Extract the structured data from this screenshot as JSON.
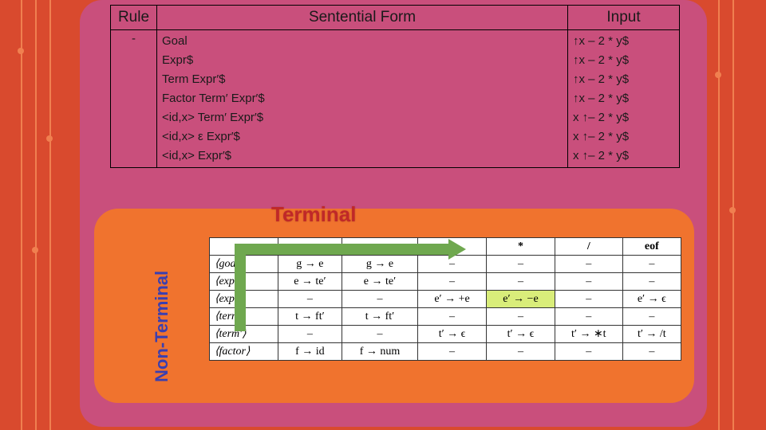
{
  "parse_table": {
    "headers": {
      "rule": "Rule",
      "sentential": "Sentential Form",
      "input": "Input"
    },
    "rule_value": "-",
    "sentential_forms": [
      "Goal",
      "Expr$",
      "Term Expr′$",
      "Factor Term′ Expr′$",
      "<id,x> Term′ Expr′$",
      "<id,x> ε Expr′$",
      "<id,x> Expr′$"
    ],
    "inputs": [
      "↑x – 2 * y$",
      "↑x – 2 * y$",
      "↑x – 2 * y$",
      "↑x – 2 * y$",
      "x ↑– 2 * y$",
      "x ↑– 2 * y$",
      "x ↑– 2 * y$"
    ]
  },
  "labels": {
    "terminal": "Terminal",
    "nonterminal": "Non-Terminal"
  },
  "ll_table": {
    "col_headers": [
      "",
      "",
      "",
      "-",
      "*",
      "/",
      "eof"
    ],
    "rows": [
      {
        "hdr": "⟨goal⟩",
        "cells": [
          "g → e",
          "g → e",
          "–",
          "–",
          "–",
          "–"
        ]
      },
      {
        "hdr": "⟨expr⟩",
        "cells": [
          "e → te′",
          "e → te′",
          "–",
          "–",
          "–",
          "–"
        ]
      },
      {
        "hdr": "⟨expr′⟩",
        "cells": [
          "–",
          "–",
          "e′ → +e",
          "e′ → −e",
          "–",
          "e′ → ϵ"
        ],
        "hl_index": 3
      },
      {
        "hdr": "⟨term⟩",
        "cells": [
          "t → ft′",
          "t → ft′",
          "–",
          "–",
          "–",
          "–"
        ]
      },
      {
        "hdr": "⟨term′⟩",
        "cells": [
          "–",
          "–",
          "t′ → ϵ",
          "t′ → ϵ",
          "t′ → ∗t",
          "t′ → /t"
        ]
      },
      {
        "hdr": "⟨factor⟩",
        "cells": [
          "f → id",
          "f → num",
          "–",
          "–",
          "–",
          "–"
        ]
      }
    ]
  }
}
